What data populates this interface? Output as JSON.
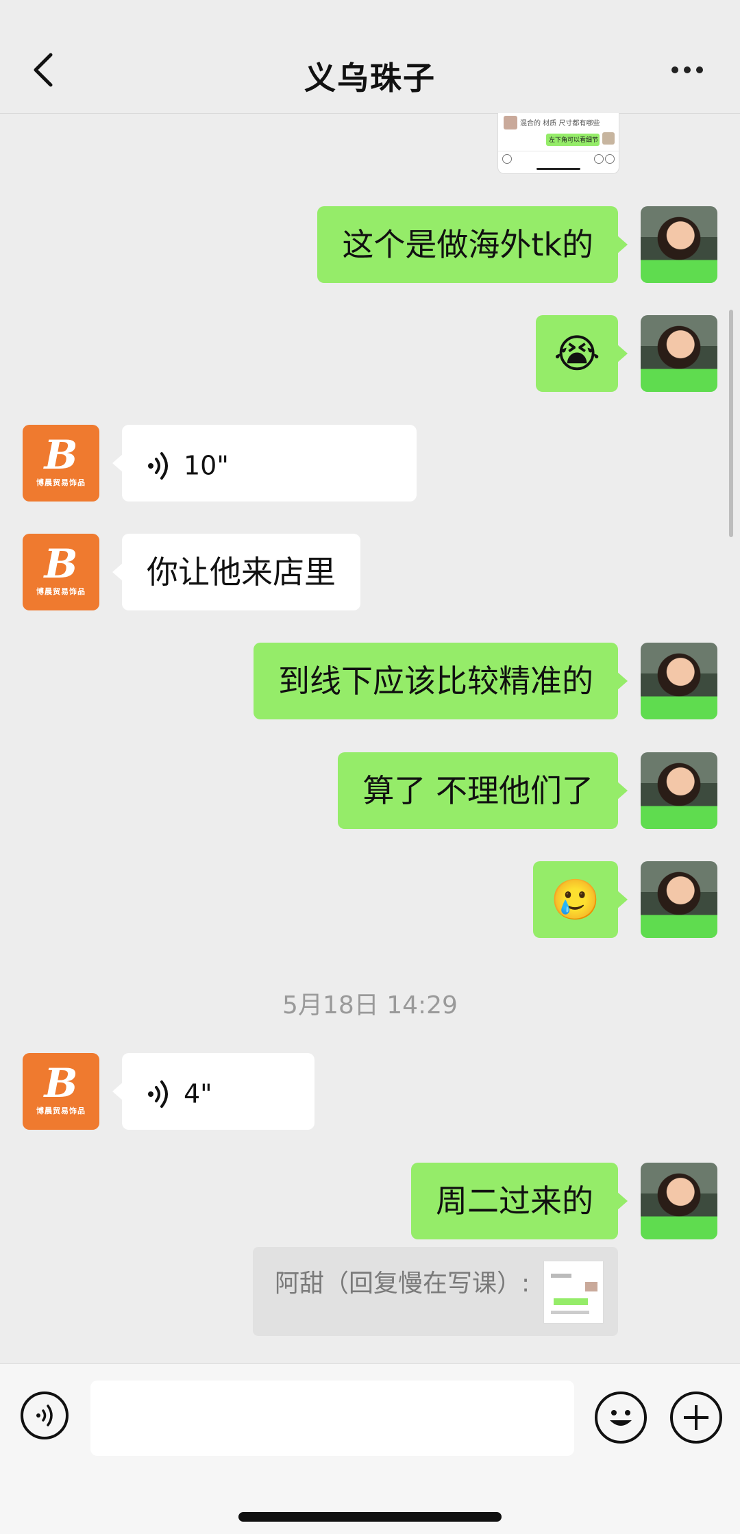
{
  "header": {
    "title": "义乌珠子",
    "back_icon": "chevron-left-icon",
    "more_icon": "more-dots-icon"
  },
  "thumbnail": {
    "line1": "混合的 材质 尺寸都有哪些",
    "line2": "左下角可以看细节"
  },
  "contact_avatar": {
    "letter": "B",
    "caption": "博晨贸易饰品"
  },
  "messages": [
    {
      "side": "me",
      "type": "text",
      "text": "这个是做海外tk的"
    },
    {
      "side": "me",
      "type": "emoji",
      "text": "😭"
    },
    {
      "side": "other",
      "type": "voice",
      "duration": "10\""
    },
    {
      "side": "other",
      "type": "text",
      "text": "你让他来店里"
    },
    {
      "side": "me",
      "type": "text",
      "text": "到线下应该比较精准的"
    },
    {
      "side": "me",
      "type": "text",
      "text": "算了 不理他们了"
    },
    {
      "side": "me",
      "type": "emoji",
      "text": "🥲"
    },
    {
      "side": "other",
      "type": "voice",
      "duration": "4\""
    },
    {
      "side": "me",
      "type": "text",
      "text": "周二过来的"
    }
  ],
  "timestamp": "5月18日 14:29",
  "quote": {
    "text": "阿甜（回复慢在写课）:"
  },
  "input_bar": {
    "voice_icon": "voice-wave-icon",
    "emoji_icon": "smiley-icon",
    "plus_icon": "plus-circle-icon",
    "placeholder": ""
  }
}
